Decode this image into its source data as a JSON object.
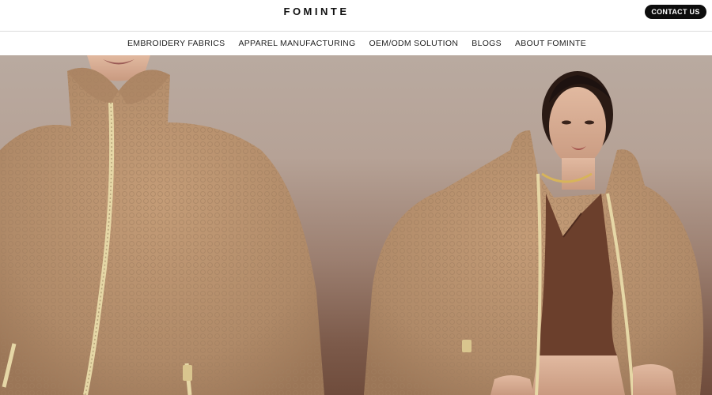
{
  "header": {
    "logo": "FOMINTE",
    "contact_label": "CONTACT US"
  },
  "nav": {
    "items": [
      {
        "label": "EMBROIDERY FABRICS"
      },
      {
        "label": "APPAREL MANUFACTURING"
      },
      {
        "label": "OEM/ODM SOLUTION"
      },
      {
        "label": "BLOGS"
      },
      {
        "label": "ABOUT FOMINTE"
      }
    ]
  },
  "hero": {
    "image": "two-models-in-teddy-fleece-jackets"
  },
  "colors": {
    "button_bg": "#0d0d0d",
    "jacket": "#b68f6c",
    "backdrop": "#b6a296"
  }
}
